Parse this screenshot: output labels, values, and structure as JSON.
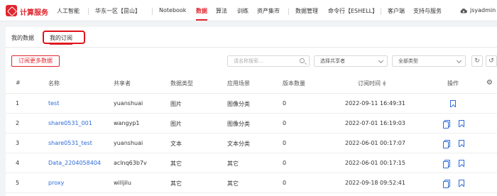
{
  "nav": {
    "brand": "计算服务",
    "items": [
      "人工智能",
      "华东一区【昆山】",
      "Notebook",
      "数据",
      "算法",
      "训练",
      "资产集市",
      "数据管理",
      "命令行【ESHELL】",
      "客户端",
      "支持与服务",
      "jsyadmin"
    ],
    "active": "数据"
  },
  "tabs": [
    "我的数据",
    "我的订阅"
  ],
  "toolbar": {
    "subscribe_more": "订阅更多数据",
    "search_placeholder": "请名称搜索...",
    "sharer_select": "选择共享者",
    "type_select": "全部类型"
  },
  "table": {
    "headers": [
      "#",
      "名称",
      "共享者",
      "数据类型",
      "应用场景",
      "版本数量",
      "订阅时间",
      "操作"
    ],
    "rows": [
      {
        "idx": "1",
        "name": "test",
        "sharer": "yuanshuai",
        "type": "图片",
        "scene": "图像分类",
        "versions": "0",
        "time": "2022-09-11 16:49:31",
        "copy": false
      },
      {
        "idx": "2",
        "name": "share0531_001",
        "sharer": "wangyp1",
        "type": "图片",
        "scene": "图像分类",
        "versions": "0",
        "time": "2022-07-01 16:19:03",
        "copy": true
      },
      {
        "idx": "3",
        "name": "share0531_test",
        "sharer": "yuanshuai",
        "type": "文本",
        "scene": "文本分类",
        "versions": "0",
        "time": "2022-06-01 00:17:07",
        "copy": true
      },
      {
        "idx": "4",
        "name": "Data_2204058404",
        "sharer": "aclnq63b7v",
        "type": "其它",
        "scene": "其它",
        "versions": "0",
        "time": "2022-06-01 00:17:15",
        "copy": true
      },
      {
        "idx": "5",
        "name": "proxy",
        "sharer": "willjilu",
        "type": "其它",
        "scene": "其它",
        "versions": "0",
        "time": "2022-09-18 09:52:41",
        "copy": true
      }
    ]
  },
  "colors": {
    "accent": "#e0262f",
    "link": "#2d6bd6"
  }
}
